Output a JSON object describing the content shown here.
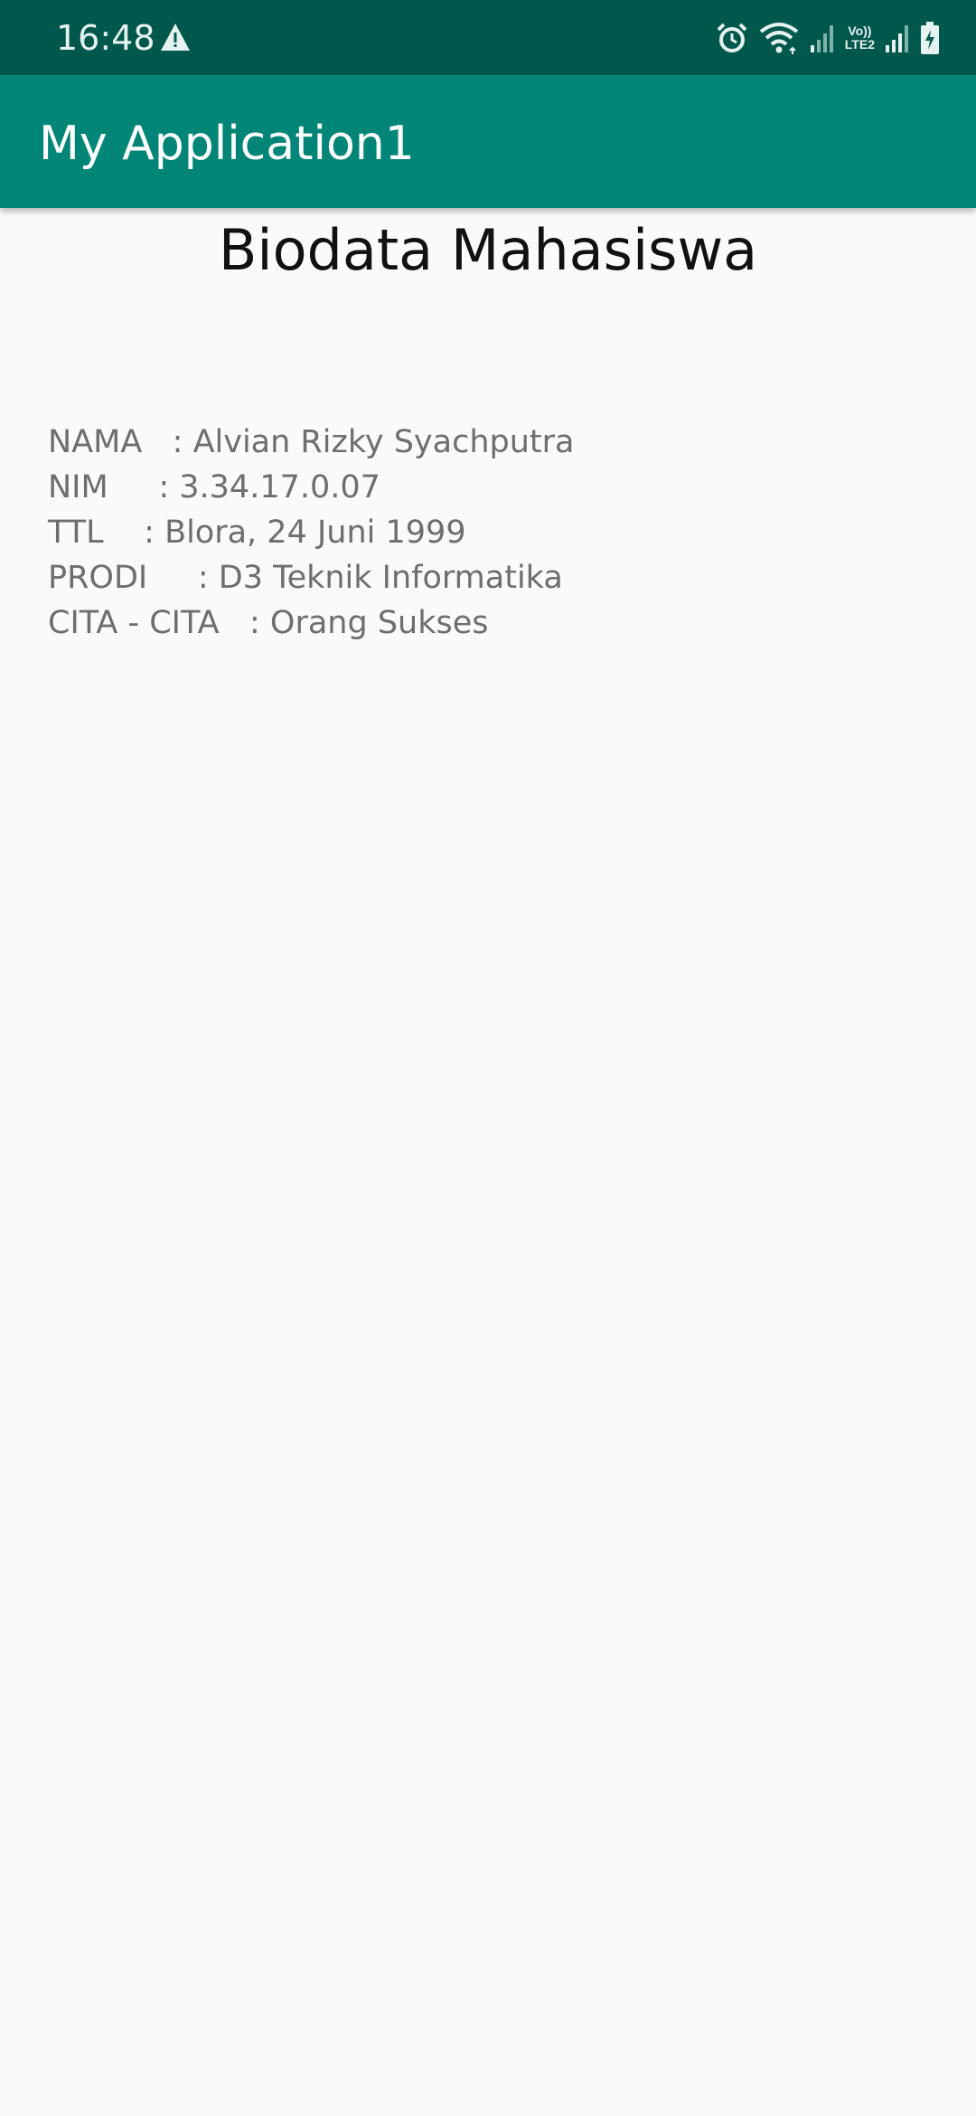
{
  "status_bar": {
    "time": "16:48",
    "volte_top": "Vo))",
    "volte_bottom": "LTE2",
    "icons": [
      "warning-icon",
      "alarm-icon",
      "wifi-icon",
      "signal-icon",
      "volte-lte-icon",
      "signal-icon",
      "battery-charging-icon"
    ]
  },
  "app_bar": {
    "title": "My Application1"
  },
  "heading": "Biodata Mahasiswa",
  "bio": [
    {
      "label": "NAMA   ",
      "value": ": Alvian Rizky Syachputra"
    },
    {
      "label": "NIM     ",
      "value": ": 3.34.17.0.07"
    },
    {
      "label": "TTL    ",
      "value": ": Blora, 24 Juni 1999"
    },
    {
      "label": "PRODI     ",
      "value": ": D3 Teknik Informatika"
    },
    {
      "label": "CITA - CITA   ",
      "value": ": Orang Sukses"
    }
  ],
  "colors": {
    "status_bar": "#00574b",
    "app_bar": "#008577",
    "background": "#fafafa"
  }
}
